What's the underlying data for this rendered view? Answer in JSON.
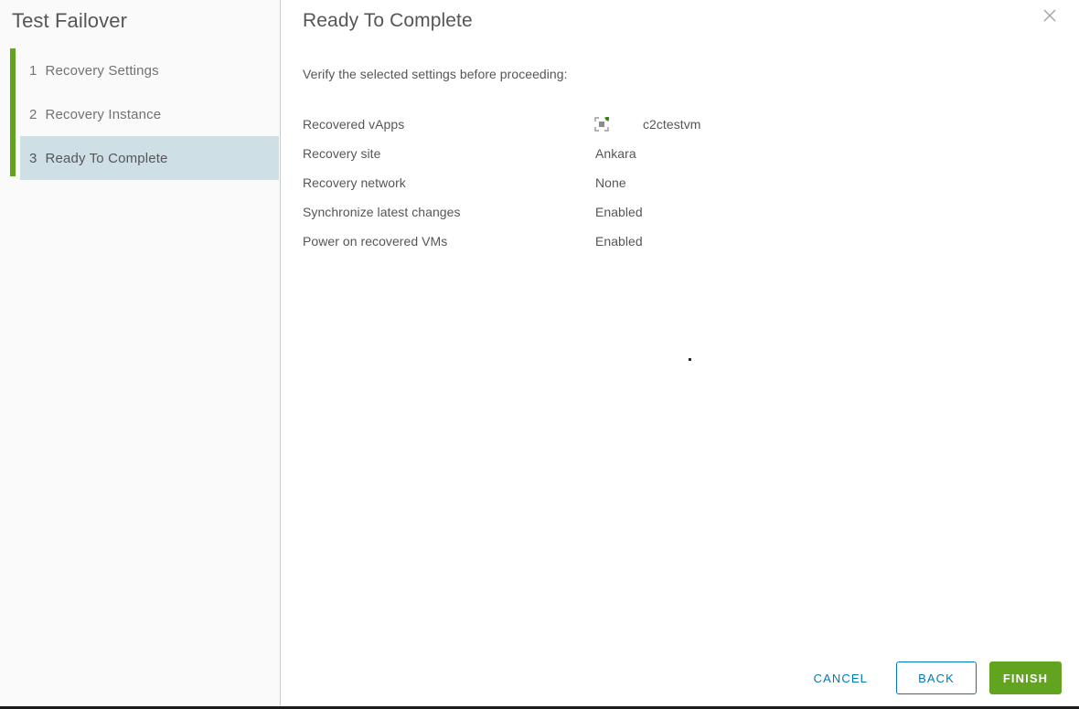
{
  "wizard": {
    "title": "Test Failover",
    "close_icon": "close-icon",
    "steps": [
      {
        "number": "1",
        "label": "Recovery Settings",
        "active": false
      },
      {
        "number": "2",
        "label": "Recovery Instance",
        "active": false
      },
      {
        "number": "3",
        "label": "Ready To Complete",
        "active": true
      }
    ]
  },
  "panel": {
    "title": "Ready To Complete",
    "subtitle": "Verify the selected settings before proceeding:"
  },
  "summary": {
    "rows": [
      {
        "label": "Recovered vApps",
        "value": "c2ctestvm",
        "icon": "vapp-icon"
      },
      {
        "label": "Recovery site",
        "value": "Ankara"
      },
      {
        "label": "Recovery network",
        "value": "None"
      },
      {
        "label": "Synchronize latest changes",
        "value": "Enabled"
      },
      {
        "label": "Power on recovered VMs",
        "value": "Enabled"
      }
    ]
  },
  "footer": {
    "cancel_label": "Cancel",
    "back_label": "Back",
    "finish_label": "Finish"
  },
  "colors": {
    "accent_green": "#62a420",
    "accent_blue": "#0079b8",
    "step_active_bg": "#cfdfe6",
    "sidebar_bg": "#fafafa",
    "text": "#565656",
    "text_muted": "#727272"
  }
}
